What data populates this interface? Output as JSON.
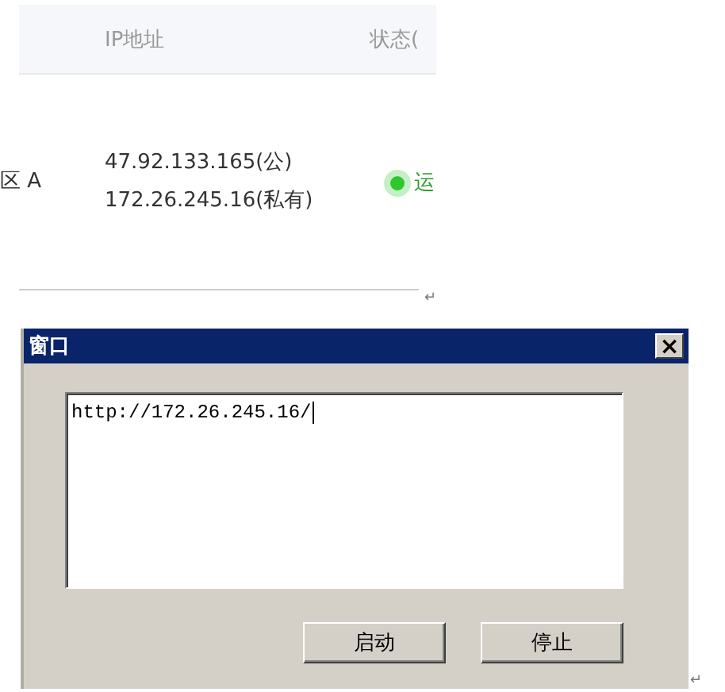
{
  "table": {
    "columns": [
      "IP地址",
      "状态("
    ],
    "rows": [
      {
        "zone": "区 A",
        "ips": [
          "47.92.133.165(公)",
          "172.26.245.16(私有)"
        ],
        "status": "运"
      }
    ]
  },
  "paragraph_marks": [
    "↵",
    "↵"
  ],
  "dialog": {
    "title": "窗口",
    "close": "×",
    "field": {
      "value": "http://172.26.245.16/",
      "focused": true
    },
    "buttons": [
      "启动",
      "停止"
    ]
  }
}
